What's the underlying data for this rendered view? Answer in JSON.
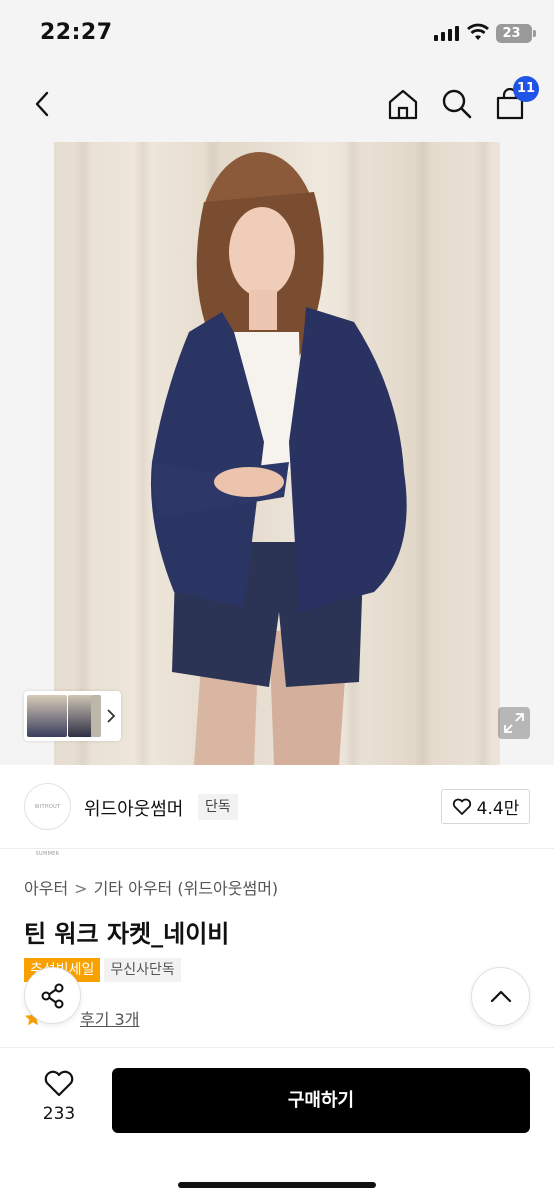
{
  "status_bar": {
    "time": "22:27",
    "battery": "23"
  },
  "nav": {
    "cart_count": "11"
  },
  "brand": {
    "name": "위드아웃썸머",
    "tag": "단독",
    "logo_text": "WITHOUT SUMMER",
    "likes": "4.4만"
  },
  "breadcrumb": {
    "category": "아우터",
    "subcategory": "기타 아우터 (위드아웃썸머)"
  },
  "product": {
    "title": "틴 워크 자켓_네이비"
  },
  "promos": [
    {
      "label": "추석빅세일"
    },
    {
      "label": "무신사단독"
    }
  ],
  "reviews": {
    "label": "후기 3개"
  },
  "bottom": {
    "wish_count": "233",
    "buy_label": "구매하기"
  },
  "colors": {
    "accent_badge": "#1f54e6",
    "promo_orange": "#f8a100",
    "buy_button": "#000000"
  }
}
